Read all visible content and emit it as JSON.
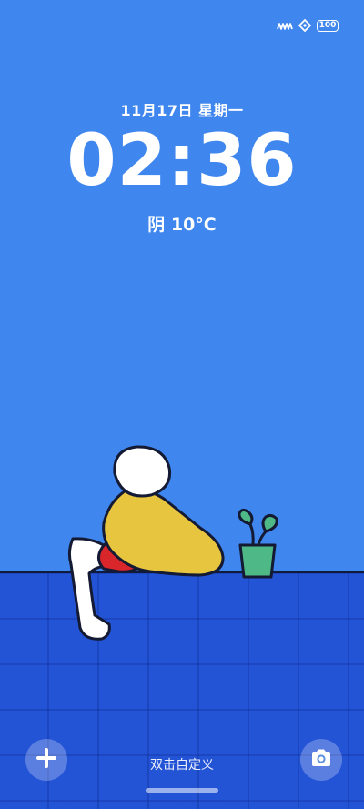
{
  "status_bar": {
    "signal_icon": "signal-icon",
    "wifi_icon": "wifi-icon",
    "battery_level": "100"
  },
  "lockscreen": {
    "date": "11月17日 星期一",
    "time": "02:36",
    "weather": "阴 10°C"
  },
  "bottom": {
    "add_icon": "plus-icon",
    "hint": "双击自定义",
    "camera_icon": "camera-icon"
  },
  "colors": {
    "background": "#3f86ee",
    "floor": "#2454d6",
    "shirt": "#e8c53e",
    "shorts": "#d9262b",
    "pot": "#4fb887"
  }
}
